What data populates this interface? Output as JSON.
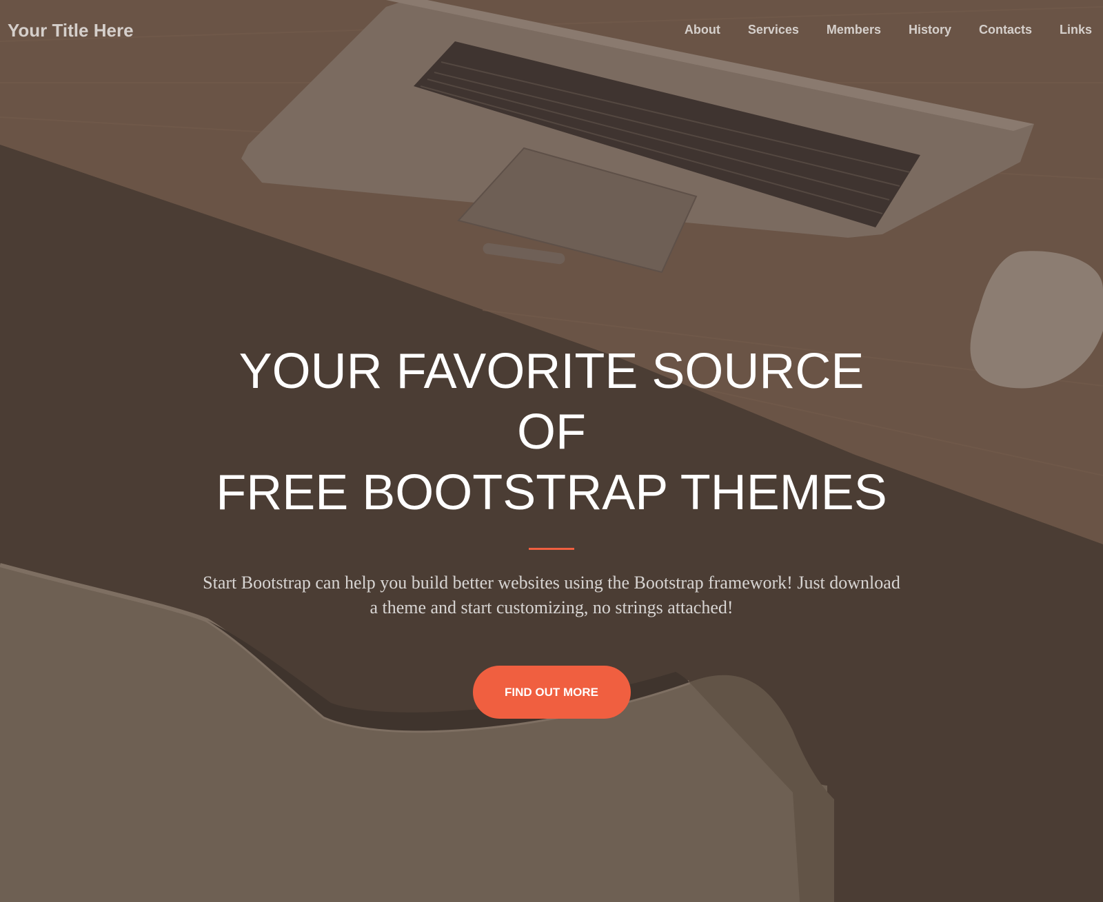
{
  "navbar": {
    "brand": "Your Title Here",
    "links": [
      "About",
      "Services",
      "Members",
      "History",
      "Contacts",
      "Links"
    ]
  },
  "hero": {
    "headline_line1": "YOUR FAVORITE SOURCE OF",
    "headline_line2": "FREE BOOTSTRAP THEMES",
    "lead": "Start Bootstrap can help you build better websites using the Bootstrap framework! Just download a theme and start customizing, no strings attached!",
    "cta_label": "FIND OUT MORE"
  },
  "colors": {
    "accent": "#f05f40",
    "overlay": "#4b3d34"
  }
}
